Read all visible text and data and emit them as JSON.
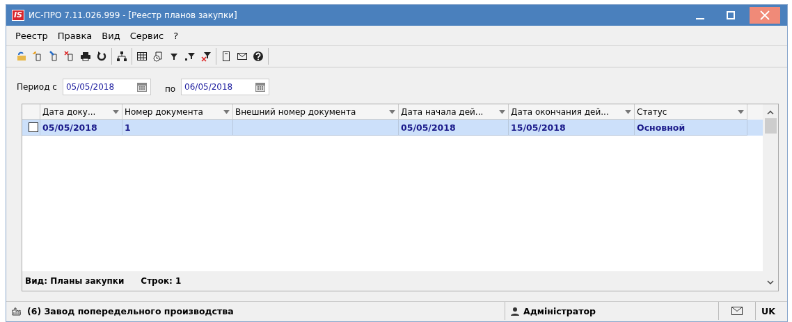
{
  "window": {
    "title": "ИС-ПРО 7.11.026.999 - [Реестр планов закупки]",
    "logo": "IS"
  },
  "menu": [
    "Реестр",
    "Правка",
    "Вид",
    "Сервис",
    "?"
  ],
  "period": {
    "from_label": "Период с",
    "from": "05/05/2018",
    "to_label": "по",
    "to": "06/05/2018"
  },
  "table": {
    "columns": [
      "Дата доку...",
      "Номер документа",
      "Внешний номер документа",
      "Дата начала дей...",
      "Дата окончания дей...",
      "Статус"
    ],
    "rows": [
      {
        "checked": false,
        "selected": true,
        "cells": [
          "05/05/2018",
          "1",
          "",
          "05/05/2018",
          "15/05/2018",
          "Основной"
        ]
      }
    ],
    "footer": {
      "view": "Вид: Планы закупки",
      "count": "Строк: 1"
    }
  },
  "status_bar": {
    "company": "(6) Завод попередельного производства",
    "user": "Адміністратор",
    "language": "UK"
  }
}
